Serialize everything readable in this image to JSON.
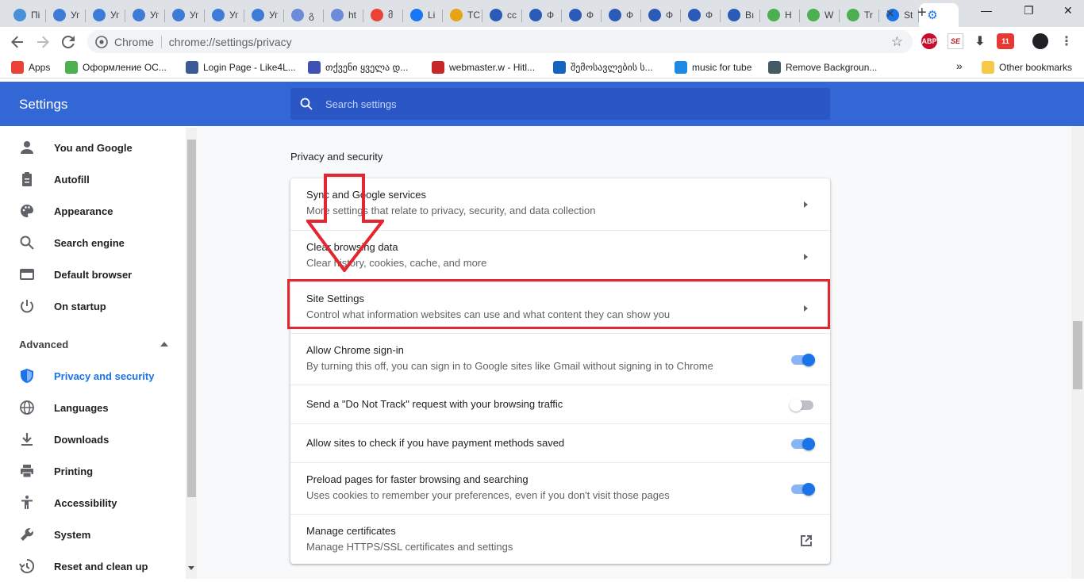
{
  "tabs": [
    {
      "label": "Пі",
      "icon": "vivaldi-icon",
      "color": "#4a90d9"
    },
    {
      "label": "Уг",
      "icon": "ucoz-icon",
      "color": "#3d7cd6"
    },
    {
      "label": "Уг",
      "icon": "ucoz-icon",
      "color": "#3d7cd6"
    },
    {
      "label": "Уг",
      "icon": "ucoz-icon",
      "color": "#3d7cd6"
    },
    {
      "label": "Уг",
      "icon": "ucoz-icon",
      "color": "#3d7cd6"
    },
    {
      "label": "Уг",
      "icon": "ucoz-icon",
      "color": "#3d7cd6"
    },
    {
      "label": "Уг",
      "icon": "ucoz-icon",
      "color": "#3d7cd6"
    },
    {
      "label": "გ",
      "icon": "vue-icon",
      "color": "#6b8bd8"
    },
    {
      "label": "ht",
      "icon": "vue-icon",
      "color": "#6b8bd8"
    },
    {
      "label": "მ",
      "icon": "google-icon",
      "color": "#ea4335"
    },
    {
      "label": "Li",
      "icon": "facebook-icon",
      "color": "#1877f2"
    },
    {
      "label": "TC",
      "icon": "chart-icon",
      "color": "#e8a317"
    },
    {
      "label": "cc",
      "icon": "zoho-icon",
      "color": "#2b5bb8"
    },
    {
      "label": "Ф",
      "icon": "zoho-icon",
      "color": "#2b5bb8"
    },
    {
      "label": "Ф",
      "icon": "zoho-icon",
      "color": "#2b5bb8"
    },
    {
      "label": "Ф",
      "icon": "zoho-icon",
      "color": "#2b5bb8"
    },
    {
      "label": "Ф",
      "icon": "zoho-icon",
      "color": "#2b5bb8"
    },
    {
      "label": "Ф",
      "icon": "zoho-icon",
      "color": "#2b5bb8"
    },
    {
      "label": "Вı",
      "icon": "zoho-icon",
      "color": "#2b5bb8"
    },
    {
      "label": "H",
      "icon": "w3-icon",
      "color": "#4caf50"
    },
    {
      "label": "W",
      "icon": "w3-icon",
      "color": "#4caf50"
    },
    {
      "label": "Tr",
      "icon": "w3-icon",
      "color": "#4caf50"
    },
    {
      "label": "St",
      "icon": "flag-icon",
      "color": "#1a73e8"
    },
    {
      "label": "",
      "icon": "gear-icon",
      "color": "#1a73e8",
      "active": true
    }
  ],
  "toolbar": {
    "site_label": "Chrome",
    "url": "chrome://settings/privacy"
  },
  "extensions": [
    {
      "label": "ABP",
      "color": "#c70d2c"
    },
    {
      "label": "SE",
      "color": "#ffffff"
    },
    {
      "label": "11",
      "color": "#e53935"
    }
  ],
  "bookmarks": [
    {
      "label": "Apps",
      "color": "#ea4335"
    },
    {
      "label": "Оформление ОС...",
      "color": "#4caf50"
    },
    {
      "label": "Login Page - Like4L...",
      "color": "#3b5998"
    },
    {
      "label": "თქვენი ყველა დ...",
      "color": "#3f51b5"
    },
    {
      "label": "webmaster.w - Hitl...",
      "color": "#c62828"
    },
    {
      "label": "შემოსავლების ს...",
      "color": "#1565c0"
    },
    {
      "label": "music for tube",
      "color": "#1e88e5"
    },
    {
      "label": "Remove Backgroun...",
      "color": "#455a64"
    }
  ],
  "bookmarks_more": "»",
  "other_bookmarks": "Other bookmarks",
  "settings": {
    "title": "Settings",
    "search_placeholder": "Search settings"
  },
  "sidebar": {
    "items": [
      {
        "label": "You and Google",
        "icon": "person-icon"
      },
      {
        "label": "Autofill",
        "icon": "clipboard-icon"
      },
      {
        "label": "Appearance",
        "icon": "palette-icon"
      },
      {
        "label": "Search engine",
        "icon": "search-icon"
      },
      {
        "label": "Default browser",
        "icon": "browser-icon"
      },
      {
        "label": "On startup",
        "icon": "power-icon"
      }
    ],
    "advanced_label": "Advanced",
    "advanced_items": [
      {
        "label": "Privacy and security",
        "icon": "shield-icon",
        "active": true
      },
      {
        "label": "Languages",
        "icon": "globe-icon"
      },
      {
        "label": "Downloads",
        "icon": "download-icon"
      },
      {
        "label": "Printing",
        "icon": "printer-icon"
      },
      {
        "label": "Accessibility",
        "icon": "accessibility-icon"
      },
      {
        "label": "System",
        "icon": "wrench-icon"
      },
      {
        "label": "Reset and clean up",
        "icon": "history-icon"
      }
    ]
  },
  "section": {
    "title": "Privacy and security",
    "rows": [
      {
        "title": "Sync and Google services",
        "subtitle": "More settings that relate to privacy, security, and data collection",
        "control": "arrow"
      },
      {
        "title": "Clear browsing data",
        "subtitle": "Clear history, cookies, cache, and more",
        "control": "arrow"
      },
      {
        "title": "Site Settings",
        "subtitle": "Control what information websites can use and what content they can show you",
        "control": "arrow"
      },
      {
        "title": "Allow Chrome sign-in",
        "subtitle": "By turning this off, you can sign in to Google sites like Gmail without signing in to Chrome",
        "control": "toggle",
        "on": true
      },
      {
        "title": "Send a \"Do Not Track\" request with your browsing traffic",
        "subtitle": "",
        "control": "toggle",
        "on": false
      },
      {
        "title": "Allow sites to check if you have payment methods saved",
        "subtitle": "",
        "control": "toggle",
        "on": true
      },
      {
        "title": "Preload pages for faster browsing and searching",
        "subtitle": "Uses cookies to remember your preferences, even if you don't visit those pages",
        "control": "toggle",
        "on": true
      },
      {
        "title": "Manage certificates",
        "subtitle": "Manage HTTPS/SSL certificates and settings",
        "control": "external"
      }
    ]
  },
  "colors": {
    "header": "#3367d6",
    "accent": "#1a73e8",
    "annotation": "#e3262f"
  }
}
